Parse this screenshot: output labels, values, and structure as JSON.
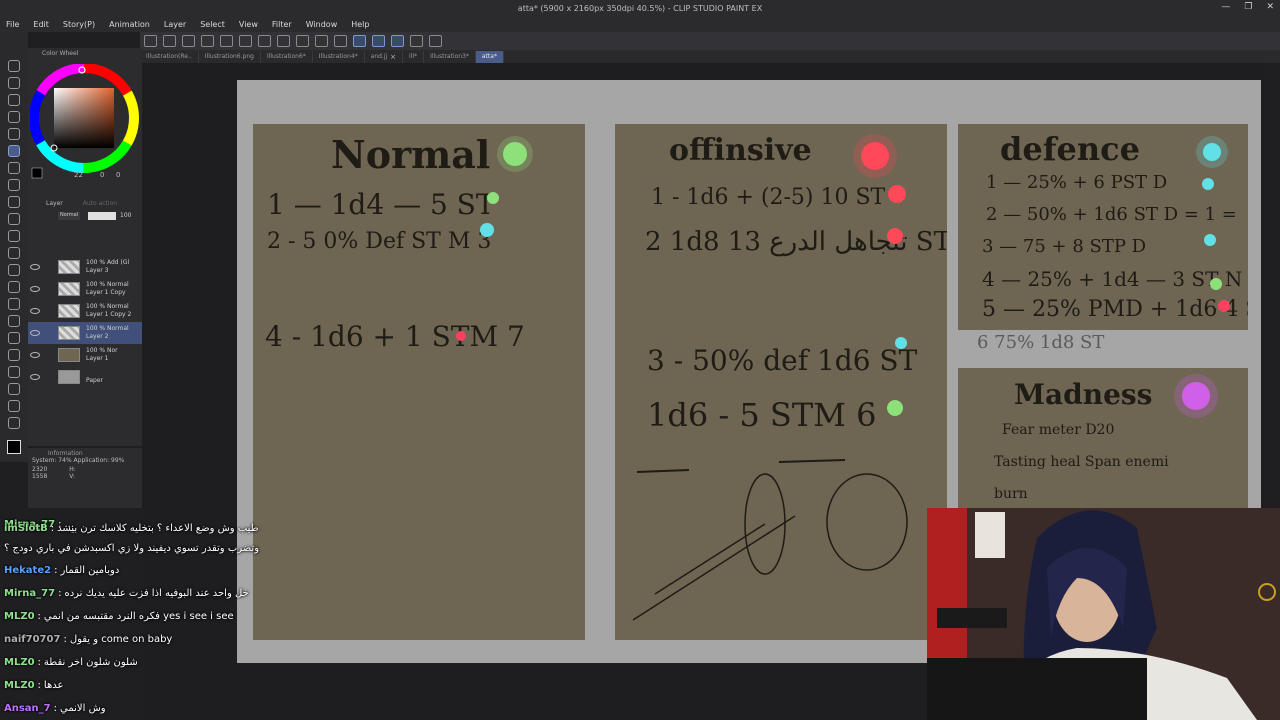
{
  "window": {
    "title": "atta* (5900 x 2160px 350dpi 40.5%) - CLIP STUDIO PAINT EX",
    "controls": [
      "—",
      "❐",
      "✕"
    ]
  },
  "menu": [
    "File",
    "Edit",
    "Story(P)",
    "Animation",
    "Layer",
    "Select",
    "View",
    "Filter",
    "Window",
    "Help"
  ],
  "tabs": [
    {
      "label": "Illustration(Re..",
      "active": false
    },
    {
      "label": "Illustration6.png",
      "active": false
    },
    {
      "label": "Illustration6*",
      "active": false
    },
    {
      "label": "Illustration4*",
      "active": false
    },
    {
      "label": "and.jj",
      "active": false
    },
    {
      "label": "ill*",
      "active": false
    },
    {
      "label": "Illustration3*",
      "active": false
    },
    {
      "label": "atta*",
      "active": true
    }
  ],
  "color_wheel": {
    "title": "Color Wheel",
    "hue_color": "#e0622c",
    "values": [
      "22",
      "0",
      "0"
    ]
  },
  "layers": {
    "tabs": [
      "Layer",
      "Auto action"
    ],
    "blend": "Normal",
    "opacity": "100",
    "rows": [
      {
        "line1": "100 % Add (Gl",
        "line2": "Layer 3",
        "active": false
      },
      {
        "line1": "100 % Normal",
        "line2": "Layer 1 Copy",
        "active": false
      },
      {
        "line1": "100 % Normal",
        "line2": "Layer 1 Copy 2",
        "active": false
      },
      {
        "line1": "100 % Normal",
        "line2": "Layer 2",
        "active": true
      },
      {
        "line1": "100 % Nor",
        "line2": "Layer 1",
        "active": false
      },
      {
        "line1": "",
        "line2": "Paper",
        "active": false
      }
    ]
  },
  "info": {
    "title": "Information",
    "system": "System: 74%  Application: 99%",
    "x": "2320",
    "y": "1558",
    "h_label": "H:",
    "v_label": "V:"
  },
  "cards": {
    "normal": {
      "title": "Normal",
      "lines": [
        "1 — 1d4 — 5 ST",
        "2 - 5 0% Def ST M 3",
        "4 - 1d6 + 1  STM 7"
      ]
    },
    "offensive": {
      "title": "offinsive",
      "lines": [
        "1 - 1d6 + (2-5) 10 ST",
        "2 1d8  تتجاهل الدرع  13 ST",
        "3 - 50% def 1d6 ST",
        "1d6 - 5  STM 6"
      ]
    },
    "defence": {
      "title": "defence",
      "lines": [
        "1 — 25% + 6 PST D",
        "2 — 50% + 1d6 ST D = 1 =",
        "3 — 75 + 8 STP D",
        "4 — 25% + 1d4 — 3 ST N",
        "5 — 25% PMD + 1d6 4 STM",
        "6  75%  1d8 ST"
      ]
    },
    "madness": {
      "title": "Madness",
      "lines": [
        "Fear meter D20",
        "Tasting heal Span enemi",
        "burn"
      ]
    }
  },
  "chat": [
    {
      "user": "Mirna_77",
      "color": "#8fe08f",
      "text": "..."
    },
    {
      "user": "imSlotB",
      "color": "#8fe08f",
      "text": "طيب وش وضع الاعداء ؟ بتخليه كلاسك ترن بيسد"
    },
    {
      "user": "",
      "color": "#ffffff",
      "text": "وتضرب وتقدر تسوي ديفيند ولا زي اكسبدشن في باري دودج ؟"
    },
    {
      "user": "Hekate2",
      "color": "#5aa0ff",
      "text": "دوبامين القمار"
    },
    {
      "user": "Mirna_77",
      "color": "#8fe08f",
      "text": "خل واحد عند البوفيه اذا فزت عليه يديك نرده"
    },
    {
      "user": "MLZ0",
      "color": "#8fe08f",
      "text": "فكره النرد مقتبسه من انمي yes i see i see"
    },
    {
      "user": "naif70707",
      "color": "#b0b0b0",
      "text": "و يقول come on baby"
    },
    {
      "user": "MLZ0",
      "color": "#8fe08f",
      "text": "شلون شلون اخر نقطة"
    },
    {
      "user": "MLZ0",
      "color": "#8fe08f",
      "text": "عدها"
    },
    {
      "user": "Ansan_7",
      "color": "#c070ff",
      "text": "وش الانمي"
    }
  ]
}
